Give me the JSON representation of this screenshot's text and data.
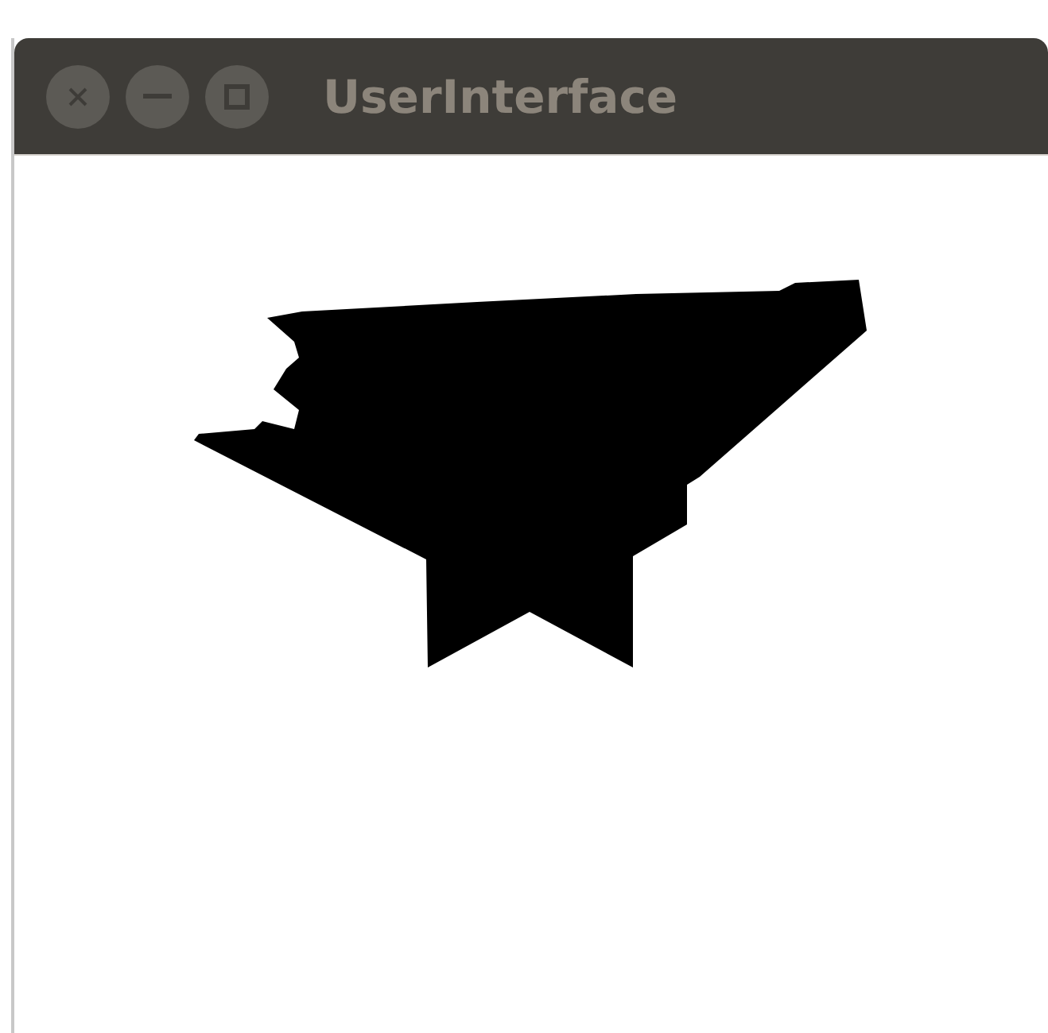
{
  "window": {
    "title": "UserInterface",
    "buttons": [
      {
        "kind": "close"
      },
      {
        "kind": "minimize"
      },
      {
        "kind": "maximize"
      }
    ]
  }
}
